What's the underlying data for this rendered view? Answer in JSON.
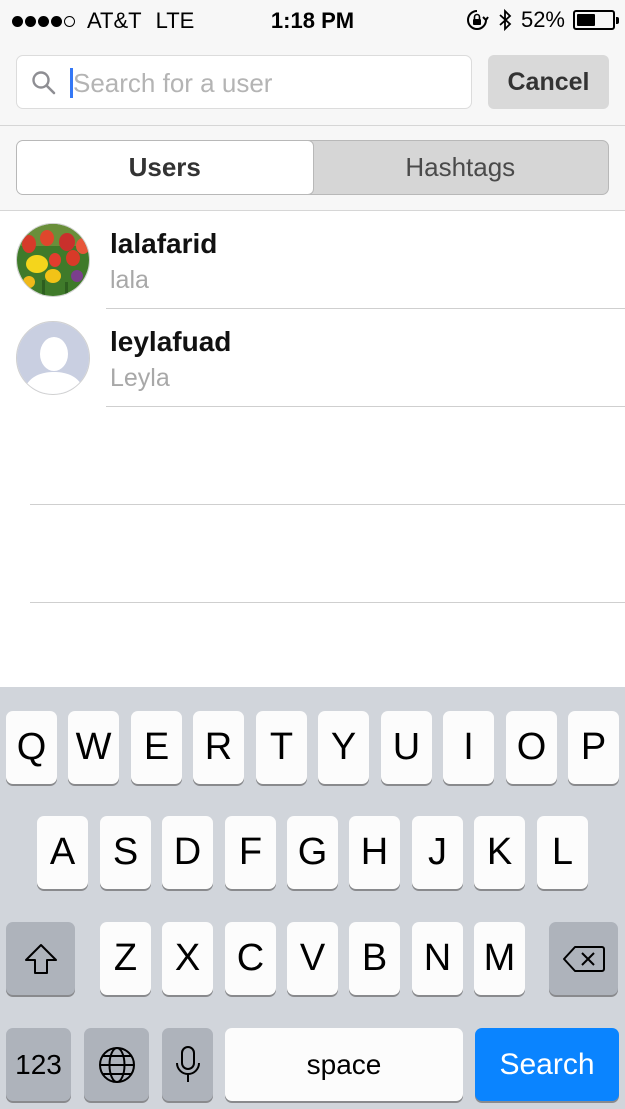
{
  "status_bar": {
    "carrier": "AT&T",
    "network": "LTE",
    "time": "1:18 PM",
    "battery": "52%",
    "battery_level": 0.52
  },
  "search": {
    "placeholder": "Search for a user",
    "value": "",
    "cancel_label": "Cancel"
  },
  "tabs": [
    {
      "label": "Users",
      "active": true
    },
    {
      "label": "Hashtags",
      "active": false
    }
  ],
  "users": [
    {
      "username": "lalafarid",
      "fullname": "lala",
      "avatar": "tulips-photo"
    },
    {
      "username": "leylafuad",
      "fullname": "Leyla",
      "avatar": "default-person"
    }
  ],
  "keyboard": {
    "row1": [
      "Q",
      "W",
      "E",
      "R",
      "T",
      "Y",
      "U",
      "I",
      "O",
      "P"
    ],
    "row2": [
      "A",
      "S",
      "D",
      "F",
      "G",
      "H",
      "J",
      "K",
      "L"
    ],
    "row3": [
      "Z",
      "X",
      "C",
      "V",
      "B",
      "N",
      "M"
    ],
    "numbers_label": "123",
    "space_label": "space",
    "search_label": "Search",
    "accent_color": "#0a84ff"
  }
}
